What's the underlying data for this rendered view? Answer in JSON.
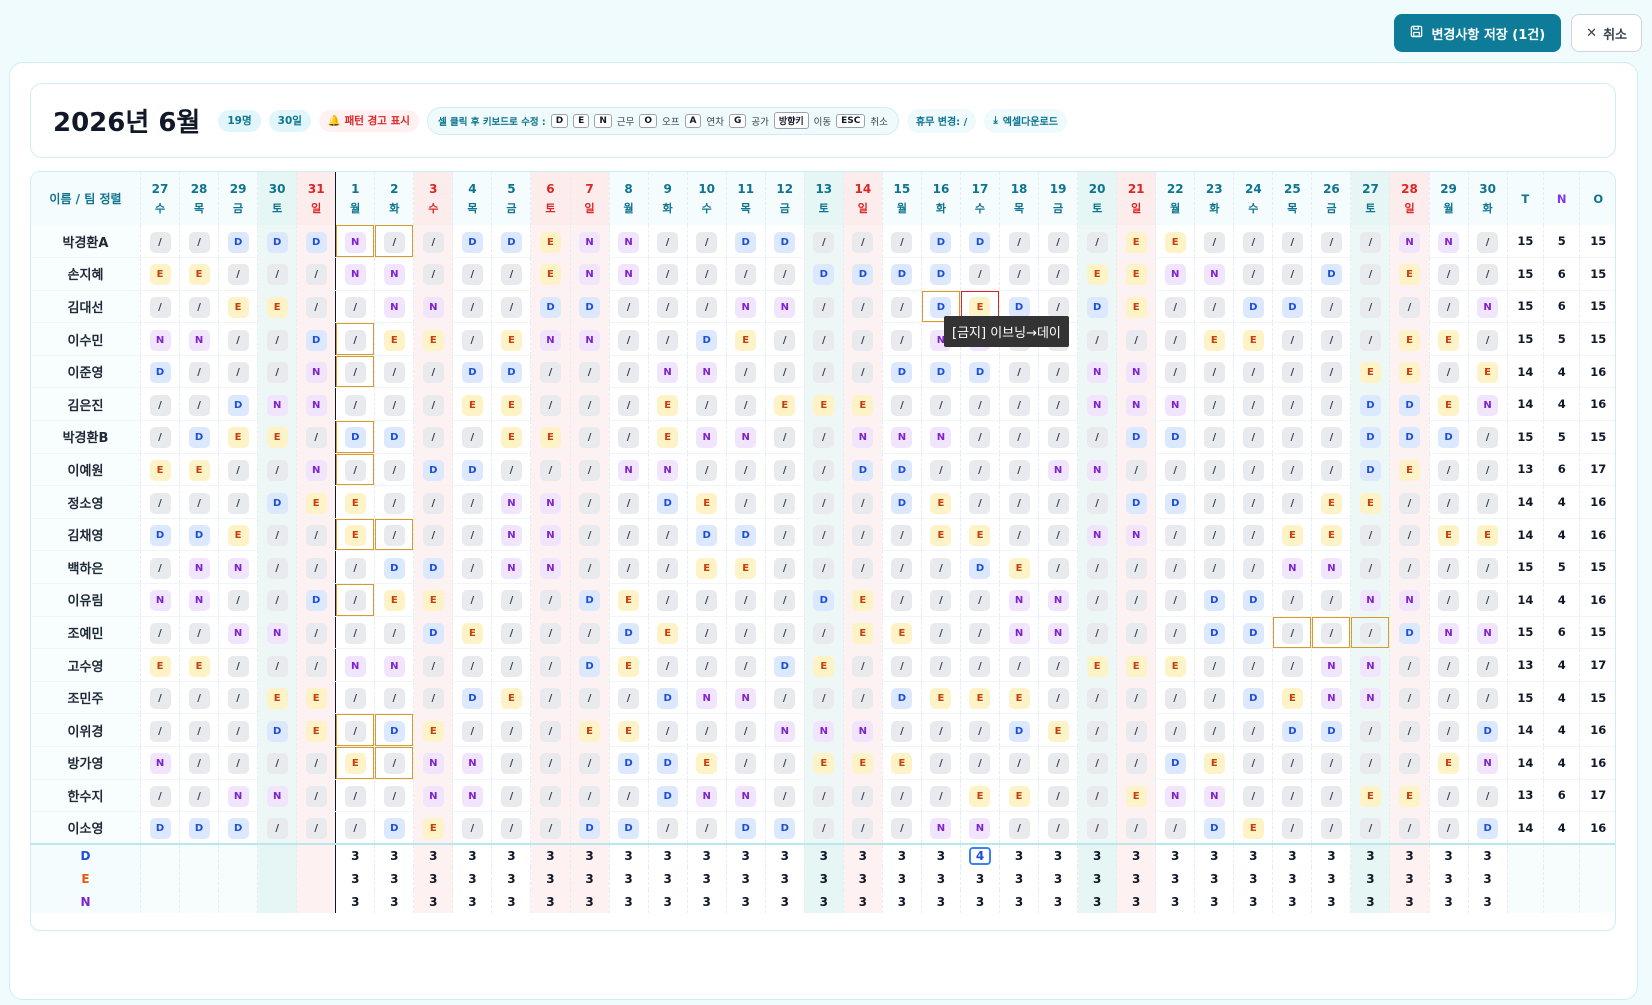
{
  "toolbar": {
    "save_label": "변경사항 저장 (1건)",
    "cancel_label": "취소"
  },
  "header": {
    "title": "2026년 6월",
    "people": "19명",
    "days": "30일",
    "pattern_warning": "🔔 패턴 경고 표시",
    "kbd_label": "셀 클릭 후 키보드로 수정 :",
    "keys": [
      "D",
      "E",
      "N"
    ],
    "work_text": "근무",
    "off_key": "O",
    "off_text": "오프",
    "annual_key": "A",
    "annual_text": "연차",
    "public_key": "G",
    "public_text": "공가",
    "arrow_key": "방향키",
    "arrow_text": "이동",
    "esc_key": "ESC",
    "esc_text": "취소",
    "holiday_change": "휴무 변경: /",
    "excel": "엑셀다운로드"
  },
  "grid": {
    "name_header": "이름 / 팀 정렬",
    "total_headers": [
      "T",
      "N",
      "O"
    ],
    "dates": [
      {
        "d": "27",
        "w": "수",
        "t": ""
      },
      {
        "d": "28",
        "w": "목",
        "t": ""
      },
      {
        "d": "29",
        "w": "금",
        "t": ""
      },
      {
        "d": "30",
        "w": "토",
        "t": "sat"
      },
      {
        "d": "31",
        "w": "일",
        "t": "sun"
      },
      {
        "d": "1",
        "w": "월",
        "t": ""
      },
      {
        "d": "2",
        "w": "화",
        "t": ""
      },
      {
        "d": "3",
        "w": "수",
        "t": "sun"
      },
      {
        "d": "4",
        "w": "목",
        "t": ""
      },
      {
        "d": "5",
        "w": "금",
        "t": ""
      },
      {
        "d": "6",
        "w": "토",
        "t": "sun"
      },
      {
        "d": "7",
        "w": "일",
        "t": "sun"
      },
      {
        "d": "8",
        "w": "월",
        "t": ""
      },
      {
        "d": "9",
        "w": "화",
        "t": ""
      },
      {
        "d": "10",
        "w": "수",
        "t": ""
      },
      {
        "d": "11",
        "w": "목",
        "t": ""
      },
      {
        "d": "12",
        "w": "금",
        "t": ""
      },
      {
        "d": "13",
        "w": "토",
        "t": "sat"
      },
      {
        "d": "14",
        "w": "일",
        "t": "sun"
      },
      {
        "d": "15",
        "w": "월",
        "t": ""
      },
      {
        "d": "16",
        "w": "화",
        "t": ""
      },
      {
        "d": "17",
        "w": "수",
        "t": ""
      },
      {
        "d": "18",
        "w": "목",
        "t": ""
      },
      {
        "d": "19",
        "w": "금",
        "t": ""
      },
      {
        "d": "20",
        "w": "토",
        "t": "sat"
      },
      {
        "d": "21",
        "w": "일",
        "t": "sun"
      },
      {
        "d": "22",
        "w": "월",
        "t": ""
      },
      {
        "d": "23",
        "w": "화",
        "t": ""
      },
      {
        "d": "24",
        "w": "수",
        "t": ""
      },
      {
        "d": "25",
        "w": "목",
        "t": ""
      },
      {
        "d": "26",
        "w": "금",
        "t": ""
      },
      {
        "d": "27",
        "w": "토",
        "t": "sat"
      },
      {
        "d": "28",
        "w": "일",
        "t": "sun"
      },
      {
        "d": "29",
        "w": "월",
        "t": ""
      },
      {
        "d": "30",
        "w": "화",
        "t": ""
      }
    ],
    "rows": [
      {
        "name": "박경환A",
        "s": "//DDDN//DDENN//DD///DD///EE/////NN//D",
        "tot": [
          "15",
          "5",
          "15"
        ],
        "chg": [
          5,
          6
        ]
      },
      {
        "name": "손지혜",
        "s": "EE///NN///ENN////DDDD///EENN//D/E///",
        "tot": [
          "15",
          "6",
          "15"
        ],
        "chg": []
      },
      {
        "name": "김대선",
        "s": "//EE//NN//DD///NN///DED/DE//DD////NN/",
        "tot": [
          "15",
          "6",
          "15"
        ],
        "chg": [
          20
        ],
        "bad": [
          21
        ]
      },
      {
        "name": "이수민",
        "s": "NN//D/EE/ENN//DE////NN/////EE///EE///",
        "tot": [
          "15",
          "5",
          "15"
        ],
        "chg": [
          5
        ]
      },
      {
        "name": "이준영",
        "s": "D///N///DD///NN////DDD//NN/////EE/EEE",
        "tot": [
          "14",
          "4",
          "16"
        ],
        "chg": [
          5
        ]
      },
      {
        "name": "김은진",
        "s": "//DNN///EE///E//EEE/////NNN////DDEN",
        "tot": [
          "14",
          "4",
          "16"
        ],
        "chg": []
      },
      {
        "name": "박경환B",
        "s": "/DEE/DD//EE//ENN//NNN////DD////DDD///",
        "tot": [
          "15",
          "5",
          "15"
        ],
        "chg": [
          5
        ]
      },
      {
        "name": "이예원",
        "s": "EE//N//DD///NN////DD///NN//////DE//NN//D",
        "tot": [
          "13",
          "6",
          "17"
        ],
        "chg": [
          5
        ]
      },
      {
        "name": "정소영",
        "s": "///DEE///NN//DE////DE////DD///EE///DNN",
        "tot": [
          "14",
          "4",
          "16"
        ],
        "chg": []
      },
      {
        "name": "김채영",
        "s": "DDE//E///NN///DD////EE//NN///EE//EEE/",
        "tot": [
          "14",
          "4",
          "16"
        ],
        "chg": [
          5,
          6
        ]
      },
      {
        "name": "백하은",
        "s": "/NN///DD/NN///EE/////DE//////NN////DE/",
        "tot": [
          "15",
          "5",
          "15"
        ],
        "chg": []
      },
      {
        "name": "이유림",
        "s": "NN//D/EE///DE////DE///NN///DD//NN///DE",
        "tot": [
          "14",
          "4",
          "16"
        ],
        "chg": [
          5
        ]
      },
      {
        "name": "조예민",
        "s": "//NN///DE///DE////EE//NN///DD///DNN//N//",
        "tot": [
          "15",
          "6",
          "15"
        ],
        "chg": [
          29,
          30,
          31
        ]
      },
      {
        "name": "고수영",
        "s": "EE///NN////DE///DE//////EEE///NN////DE//",
        "tot": [
          "13",
          "4",
          "17"
        ],
        "chg": []
      },
      {
        "name": "조민주",
        "s": "///EE///DE///DNN///DEEE/////DEN N////DD//",
        "tot": [
          "15",
          "4",
          "15"
        ],
        "chg": []
      },
      {
        "name": "이위경",
        "s": "///DE/DE///EE///NNN///DE/////DD///DD//N",
        "tot": [
          "14",
          "4",
          "16"
        ],
        "chg": [
          5,
          6
        ]
      },
      {
        "name": "방가영",
        "s": "N////E/NN///DDE//EEE//////DE/////ENN//",
        "tot": [
          "14",
          "4",
          "16"
        ],
        "chg": [
          5,
          6
        ]
      },
      {
        "name": "한수지",
        "s": "//NN///NN////DNN/////EE//ENN///EE///D",
        "tot": [
          "13",
          "6",
          "17"
        ],
        "chg": []
      },
      {
        "name": "이소영",
        "s": "DDD///DE///DD//DD///NN/////DE/////DD//NN//",
        "tot": [
          "14",
          "4",
          "16"
        ],
        "chg": []
      }
    ],
    "footer": {
      "labels": [
        "D",
        "E",
        "N"
      ],
      "D": [
        "3",
        "3",
        "3",
        "3",
        "3",
        "3",
        "3",
        "3",
        "3",
        "3",
        "3",
        "3",
        "3",
        "3",
        "3",
        "3",
        "4",
        "3",
        "3",
        "3",
        "3",
        "3",
        "3",
        "3",
        "3",
        "3",
        "3",
        "3",
        "3",
        "3"
      ],
      "E": [
        "3",
        "3",
        "3",
        "3",
        "3",
        "3",
        "3",
        "3",
        "3",
        "3",
        "3",
        "3",
        "3",
        "3",
        "3",
        "3",
        "3",
        "3",
        "3",
        "3",
        "3",
        "3",
        "3",
        "3",
        "3",
        "3",
        "3",
        "3",
        "3",
        "3"
      ],
      "N": [
        "3",
        "3",
        "3",
        "3",
        "3",
        "3",
        "3",
        "3",
        "3",
        "3",
        "3",
        "3",
        "3",
        "3",
        "3",
        "3",
        "3",
        "3",
        "3",
        "3",
        "3",
        "3",
        "3",
        "3",
        "3",
        "3",
        "3",
        "3",
        "3",
        "3"
      ],
      "highlight_index": 16
    }
  },
  "tooltip": "[금지] 이브닝→데이",
  "colors": {
    "accent": "#0e7c98",
    "day": "#1d4ed8",
    "evening": "#c2410c",
    "night": "#7e22ce",
    "warning": "#dc2626"
  }
}
